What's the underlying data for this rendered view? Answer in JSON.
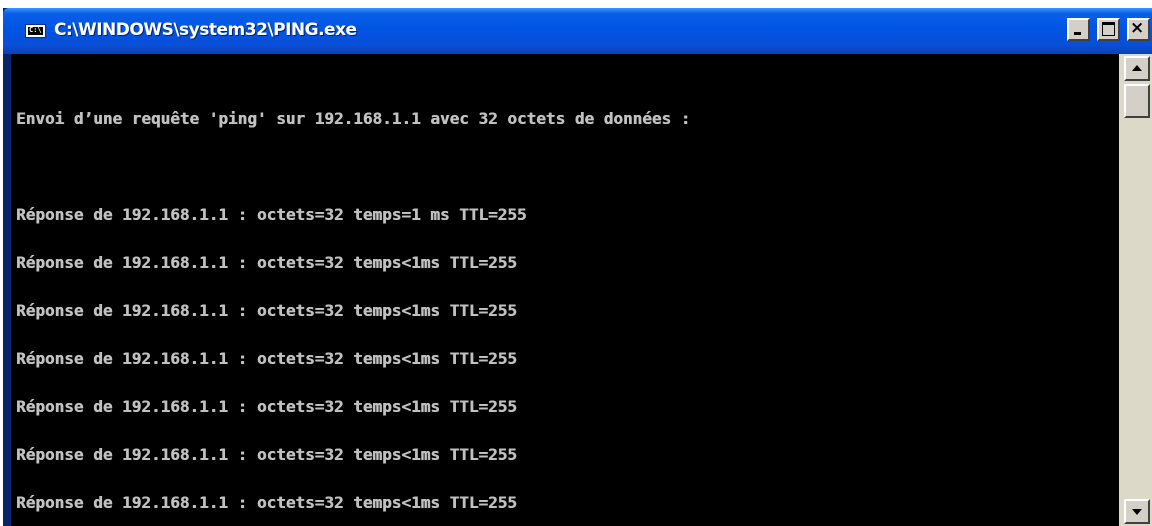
{
  "window": {
    "title": "C:\\WINDOWS\\system32\\PING.exe",
    "icon": "console-icon",
    "icon_glyph": "C:\\"
  },
  "title_buttons": {
    "minimize_icon": "minimize-icon",
    "maximize_icon": "maximize-icon",
    "close_icon": "close-icon",
    "close_glyph": "×"
  },
  "console": {
    "intro": "Envoi d’une requête 'ping' sur 192.168.1.1 avec 32 octets de données :",
    "replies": [
      "Réponse de 192.168.1.1 : octets=32 temps=1 ms TTL=255",
      "Réponse de 192.168.1.1 : octets=32 temps<1ms TTL=255",
      "Réponse de 192.168.1.1 : octets=32 temps<1ms TTL=255",
      "Réponse de 192.168.1.1 : octets=32 temps<1ms TTL=255",
      "Réponse de 192.168.1.1 : octets=32 temps<1ms TTL=255",
      "Réponse de 192.168.1.1 : octets=32 temps<1ms TTL=255",
      "Réponse de 192.168.1.1 : octets=32 temps<1ms TTL=255"
    ],
    "text_color": "#c0c0c0",
    "background_color": "#000000"
  },
  "scrollbar": {
    "up_icon": "arrow-up-icon",
    "down_icon": "arrow-down-icon"
  },
  "colors": {
    "titlebar": "#0054e3",
    "button_face": "#d4d0c8"
  }
}
